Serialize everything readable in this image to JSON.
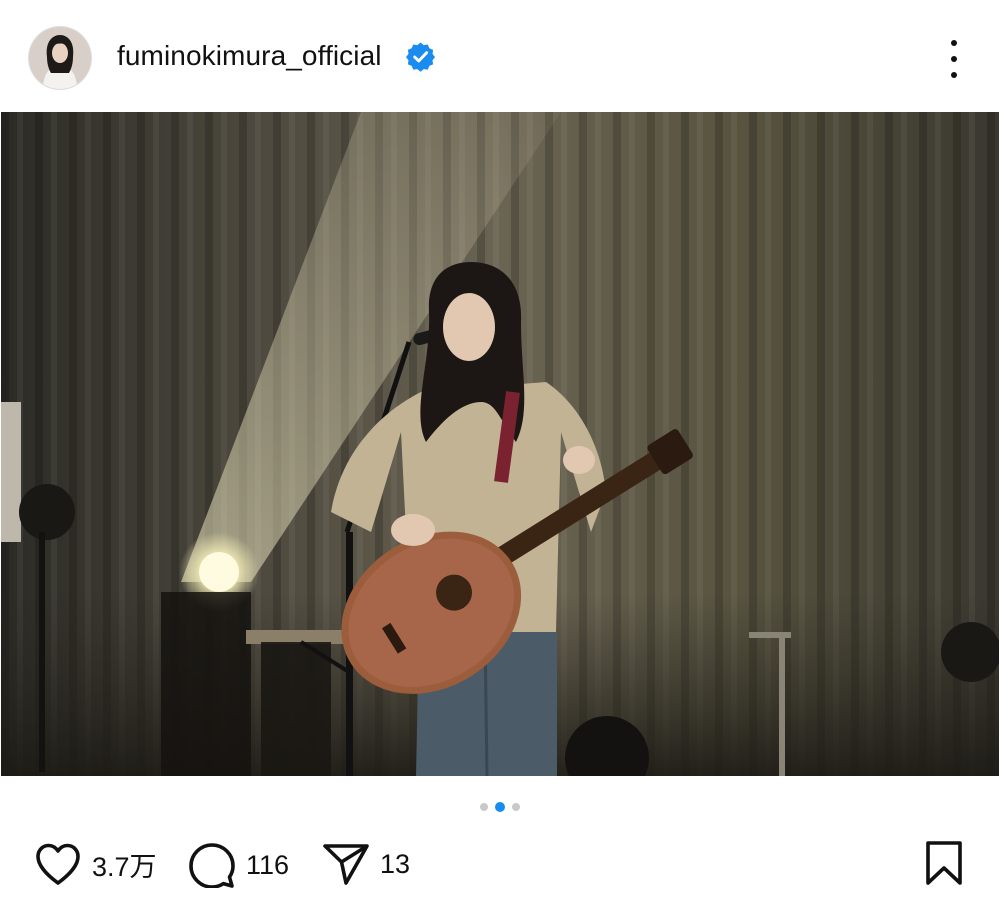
{
  "post": {
    "username": "fuminokimura_official",
    "verified": true,
    "more_icon": "more-vertical-icon",
    "carousel": {
      "count": 3,
      "active_index": 1
    },
    "likes": "3.7万",
    "comments": "116",
    "shares": "13"
  },
  "colors": {
    "verified_badge": "#1a8cf0",
    "active_dot": "#1a8cf0",
    "inactive_dot": "#c9c9c9",
    "text": "#111111"
  }
}
